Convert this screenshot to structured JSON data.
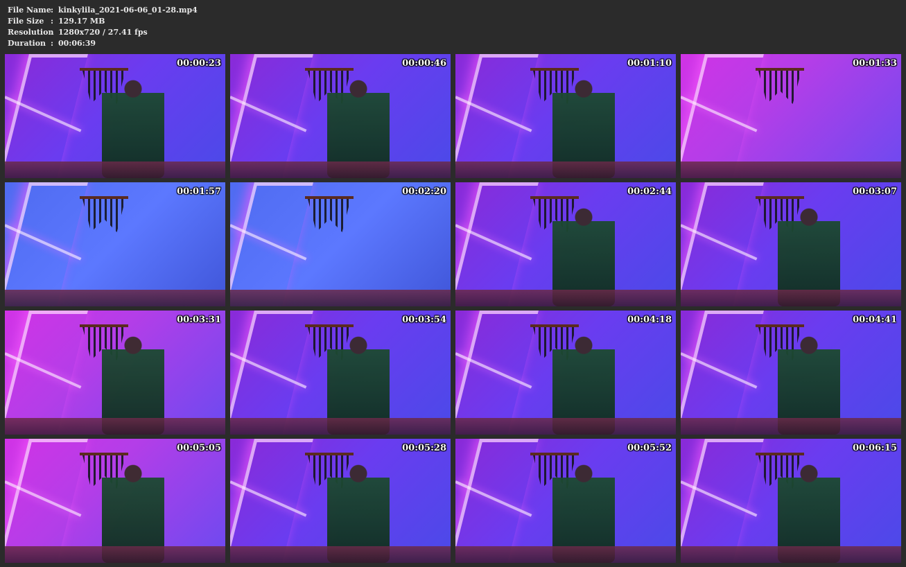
{
  "info": {
    "file_name_label": "File Name",
    "file_name_value": "kinkylila_2021-06-06_01-28.mp4",
    "file_size_label": "File Size",
    "file_size_value": "129.17 MB",
    "resolution_label": "Resolution",
    "resolution_value": "1280x720 / 27.41 fps",
    "duration_label": "Duration",
    "duration_value": "00:06:39",
    "separator": ":"
  },
  "thumbnails": [
    {
      "time": "00:00:23",
      "tone": "default"
    },
    {
      "time": "00:00:46",
      "tone": "default"
    },
    {
      "time": "00:01:10",
      "tone": "default"
    },
    {
      "time": "00:01:33",
      "tone": "pink"
    },
    {
      "time": "00:01:57",
      "tone": "blue"
    },
    {
      "time": "00:02:20",
      "tone": "blue"
    },
    {
      "time": "00:02:44",
      "tone": "default"
    },
    {
      "time": "00:03:07",
      "tone": "default"
    },
    {
      "time": "00:03:31",
      "tone": "pink"
    },
    {
      "time": "00:03:54",
      "tone": "default"
    },
    {
      "time": "00:04:18",
      "tone": "default"
    },
    {
      "time": "00:04:41",
      "tone": "default"
    },
    {
      "time": "00:05:05",
      "tone": "pink"
    },
    {
      "time": "00:05:28",
      "tone": "default"
    },
    {
      "time": "00:05:52",
      "tone": "default"
    },
    {
      "time": "00:06:15",
      "tone": "default"
    }
  ]
}
